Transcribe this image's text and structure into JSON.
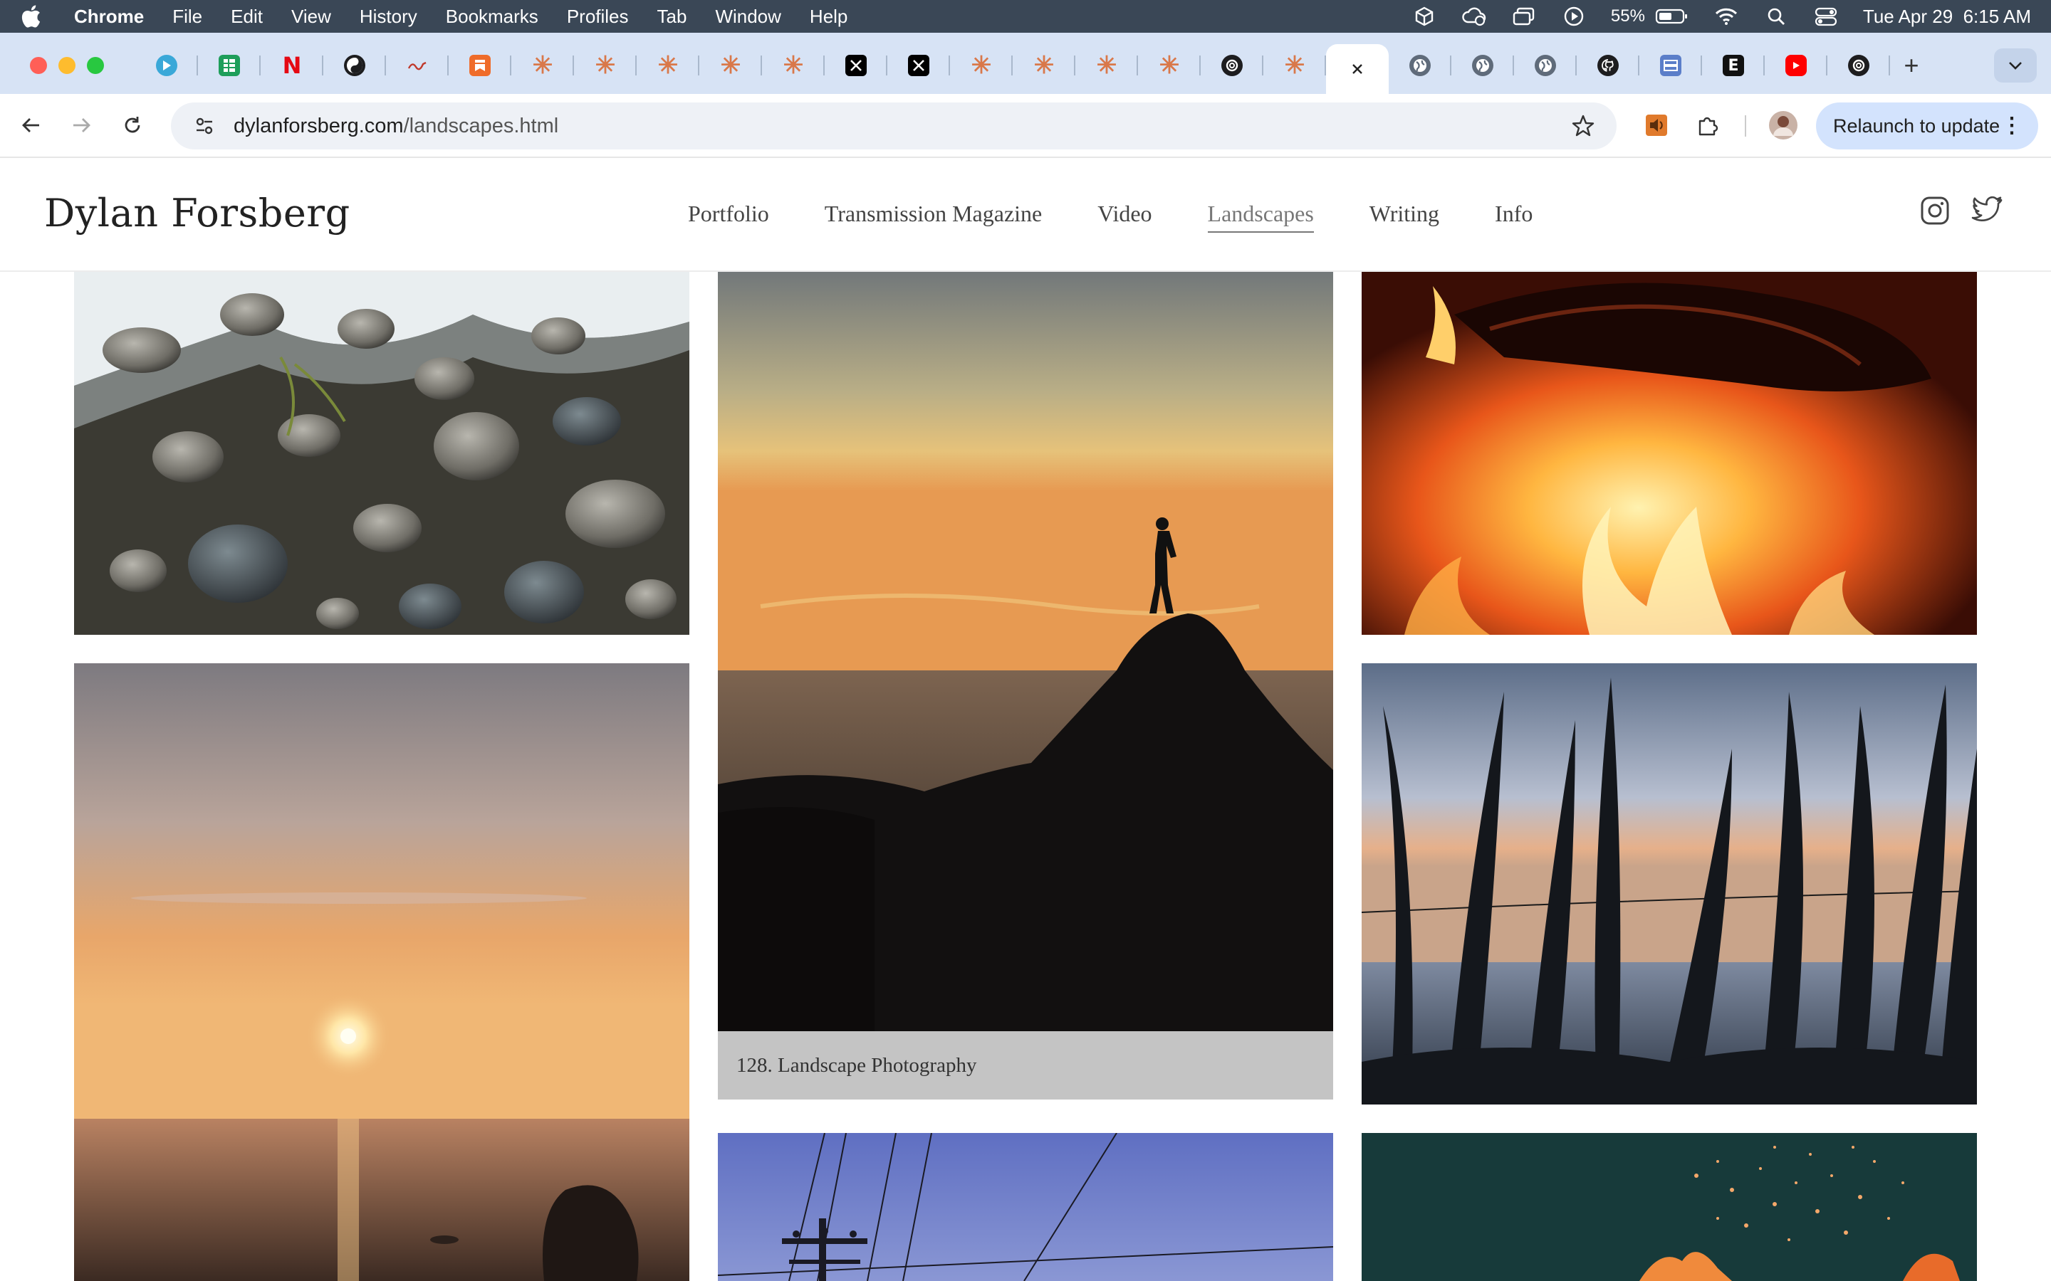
{
  "menubar": {
    "app_name": "Chrome",
    "items": [
      "File",
      "Edit",
      "View",
      "History",
      "Bookmarks",
      "Profiles",
      "Tab",
      "Window",
      "Help"
    ],
    "battery": "55%",
    "datetime": "Tue Apr 29  6:15 AM"
  },
  "tabs": [
    {
      "icon": "play-icon"
    },
    {
      "icon": "sheets-icon"
    },
    {
      "icon": "netflix-icon",
      "letter": "N"
    },
    {
      "icon": "swirl-icon"
    },
    {
      "icon": "wave-icon"
    },
    {
      "icon": "bookmark-app-icon"
    },
    {
      "icon": "claude-icon"
    },
    {
      "icon": "claude-icon"
    },
    {
      "icon": "claude-icon"
    },
    {
      "icon": "claude-icon"
    },
    {
      "icon": "claude-icon"
    },
    {
      "icon": "x-icon"
    },
    {
      "icon": "x-icon"
    },
    {
      "icon": "claude-icon"
    },
    {
      "icon": "claude-icon"
    },
    {
      "icon": "claude-icon"
    },
    {
      "icon": "claude-icon"
    },
    {
      "icon": "openai-icon"
    },
    {
      "icon": "claude-icon"
    },
    {
      "icon": "close-icon",
      "active": true
    },
    {
      "icon": "globe-icon"
    },
    {
      "icon": "globe-icon"
    },
    {
      "icon": "globe-icon"
    },
    {
      "icon": "github-icon"
    },
    {
      "icon": "server-icon"
    },
    {
      "icon": "e-icon",
      "letter": "E"
    },
    {
      "icon": "youtube-icon"
    },
    {
      "icon": "openai-icon"
    }
  ],
  "address_bar": {
    "domain": "dylanforsberg.com",
    "path": "/landscapes.html"
  },
  "relaunch_label": "Relaunch to update",
  "site": {
    "title": "Dylan Forsberg",
    "nav": [
      "Portfolio",
      "Transmission Magazine",
      "Video",
      "Landscapes",
      "Writing",
      "Info"
    ],
    "active_nav": "Landscapes"
  },
  "photos": [
    {
      "name": "beach-pebbles-photo"
    },
    {
      "name": "silhouette-cliff-sunset-photo",
      "caption": "128. Landscape Photography"
    },
    {
      "name": "campfire-flames-photo"
    },
    {
      "name": "ocean-sunset-photo"
    },
    {
      "name": "pampas-grass-sunset-photo"
    },
    {
      "name": "power-lines-sky-photo"
    },
    {
      "name": "fire-sparks-photo"
    }
  ]
}
